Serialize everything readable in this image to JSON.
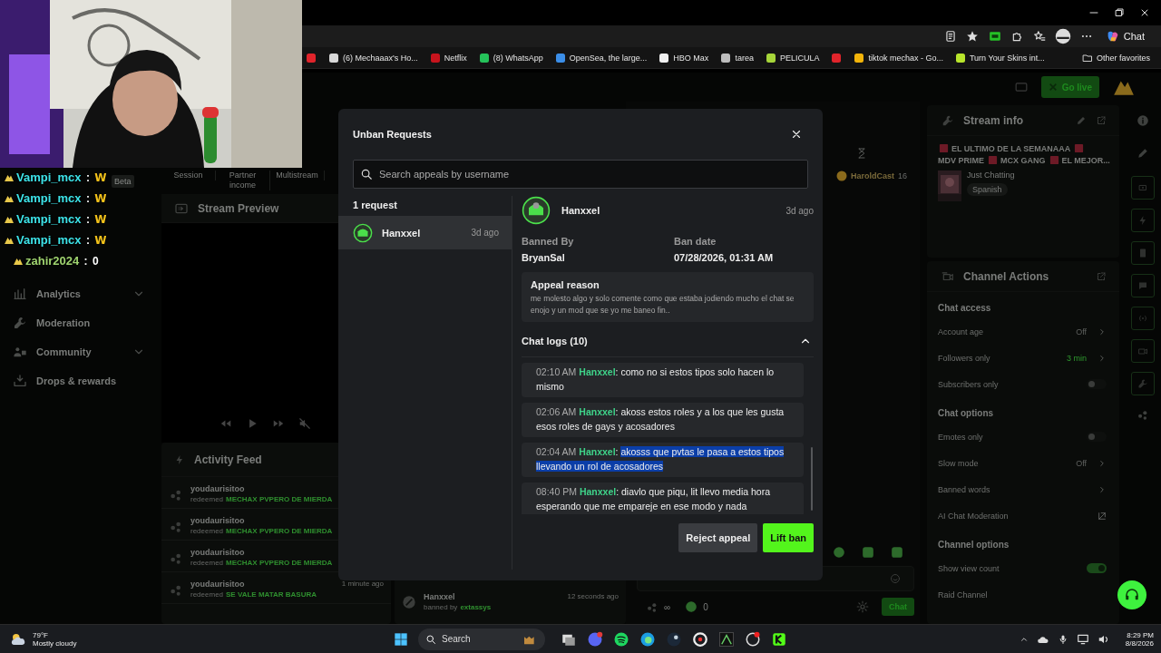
{
  "browser": {
    "chat_label": "Chat",
    "other_favorites": "Other favorites",
    "bookmarks": [
      {
        "color": "#e0242b"
      },
      {
        "label": "(6) Mechaaax's Ho...",
        "color": "#d8d8d8"
      },
      {
        "label": "Netflix",
        "color": "#c7141d"
      },
      {
        "label": "(8) WhatsApp",
        "color": "#25c25a"
      },
      {
        "label": "OpenSea, the large...",
        "color": "#3b8ee8"
      },
      {
        "label": "HBO Max",
        "color": "#f0f0f0"
      },
      {
        "label": "tarea",
        "color": "#bdbdbd"
      },
      {
        "label": "PELICULA",
        "color": "#a6d53a"
      },
      {
        "color": "#e0242b"
      },
      {
        "label": "tiktok mechax - Go...",
        "color": "#f2b40a"
      },
      {
        "label": "Turn Your Skins int...",
        "color": "#b8e52c"
      }
    ]
  },
  "app_header": {
    "go_live": "Go live"
  },
  "overlay_chat": {
    "separator": " : ",
    "lines": [
      {
        "user": "Vampi_mcx",
        "message": "W",
        "kind": "emote",
        "color": "#3de3e8"
      },
      {
        "user": "Vampi_mcx",
        "message": "W",
        "kind": "emote",
        "color": "#3de3e8"
      },
      {
        "user": "Vampi_mcx",
        "message": "W",
        "kind": "emote",
        "color": "#3de3e8"
      },
      {
        "user": "Vampi_mcx",
        "message": "W",
        "kind": "emote",
        "color": "#3de3e8"
      },
      {
        "user": "zahir2024",
        "message": "0",
        "kind": "text",
        "color": "#9fd36f"
      }
    ]
  },
  "sidebar": {
    "items": [
      {
        "label": "Analytics",
        "kind": "group",
        "expanded": false
      },
      {
        "label": "Moderation",
        "kind": "link"
      },
      {
        "label": "Community",
        "kind": "group",
        "expanded": false
      },
      {
        "label": "Drops & rewards",
        "kind": "link"
      }
    ]
  },
  "beta_badge": "Beta",
  "tabs": [
    {
      "label": "Session"
    },
    {
      "label": "Partner income"
    },
    {
      "label": "Multistream"
    }
  ],
  "stream_preview": {
    "title": "Stream Preview"
  },
  "activity_feed": {
    "title": "Activity Feed",
    "events": [
      {
        "user": "youdaurisitoo",
        "action": "redeemed",
        "reward": "MECHAX PVPERO DE MIERDA"
      },
      {
        "user": "youdaurisitoo",
        "action": "redeemed",
        "reward": "MECHAX PVPERO DE MIERDA"
      },
      {
        "user": "youdaurisitoo",
        "action": "redeemed",
        "reward": "MECHAX PVPERO DE MIERDA"
      },
      {
        "user": "youdaurisitoo",
        "action": "redeemed",
        "reward": "SE VALE MATAR BASURA",
        "time": "1 minute ago"
      }
    ]
  },
  "ban_feed": {
    "user": "Hanxxel",
    "action": "banned by",
    "moderator": "extassys",
    "time": "12 seconds ago"
  },
  "chat": {
    "channel": "HaroldCast",
    "count": "16",
    "viewers": "∞",
    "points": "0",
    "send": "Chat"
  },
  "stream_info": {
    "title": "Stream info",
    "title_parts": [
      "EL ULTIMO DE LA SEMANAAA",
      "MDV PRIME",
      "MCX GANG",
      "EL MEJOR..."
    ],
    "category": "Just Chatting",
    "tag": "Spanish"
  },
  "channel_actions": {
    "title": "Channel Actions",
    "sections": [
      {
        "heading": "Chat access",
        "rows": [
          {
            "kind": "value",
            "label": "Account age",
            "value": "Off",
            "active": false
          },
          {
            "kind": "value",
            "label": "Followers only",
            "value": "3 min",
            "active": true
          },
          {
            "kind": "toggle",
            "label": "Subscribers only",
            "on": false
          }
        ]
      },
      {
        "heading": "Chat options",
        "rows": [
          {
            "kind": "toggle",
            "label": "Emotes only",
            "on": false
          },
          {
            "kind": "value",
            "label": "Slow mode",
            "value": "Off",
            "active": false
          },
          {
            "kind": "link",
            "label": "Banned words"
          },
          {
            "kind": "external",
            "label": "AI Chat Moderation"
          }
        ]
      },
      {
        "heading": "Channel options",
        "rows": [
          {
            "kind": "toggle",
            "label": "Show view count",
            "on": true
          },
          {
            "kind": "plain",
            "label": "Raid Channel"
          }
        ]
      }
    ]
  },
  "modal": {
    "title": "Unban Requests",
    "search_placeholder": "Search appeals by username",
    "count": "1 request",
    "requests": [
      {
        "user": "Hanxxel",
        "time": "3d ago",
        "selected": true
      }
    ],
    "detail": {
      "user": "Hanxxel",
      "time": "3d ago",
      "banned_by_label": "Banned By",
      "banned_by": "BryanSal",
      "ban_date_label": "Ban date",
      "ban_date": "07/28/2026, 01:31 AM",
      "appeal_label": "Appeal reason",
      "appeal_text": "me molesto algo y solo comente como que estaba jodiendo mucho el chat se enojo y un mod que se yo me baneo fin.."
    },
    "chat_logs": {
      "title": "Chat logs (10)",
      "expanded": true,
      "separator": ":",
      "logs": [
        {
          "time": "02:10 AM",
          "user": "Hanxxel",
          "text": "como no si estos tipos solo hacen lo mismo",
          "selected": false
        },
        {
          "time": "02:06 AM",
          "user": "Hanxxel",
          "text": "akoss estos roles y a los que les gusta esos roles de gays y acosadores",
          "selected": false
        },
        {
          "time": "02:04 AM",
          "user": "Hanxxel",
          "text": "akosss que pvtas le pasa a estos tipos llevando un rol de acosadores",
          "selected": true
        },
        {
          "time": "08:40 PM",
          "user": "Hanxxel",
          "text": "diavlo que piqu, lit llevo media hora esperando que me empareje en ese modo y nada",
          "selected": false
        }
      ]
    },
    "reject": "Reject appeal",
    "lift": "Lift ban"
  },
  "taskbar": {
    "temperature": "79°F",
    "condition": "Mostly cloudy",
    "search": "Search",
    "time": "8:29 PM",
    "date": "8/8/2026"
  }
}
